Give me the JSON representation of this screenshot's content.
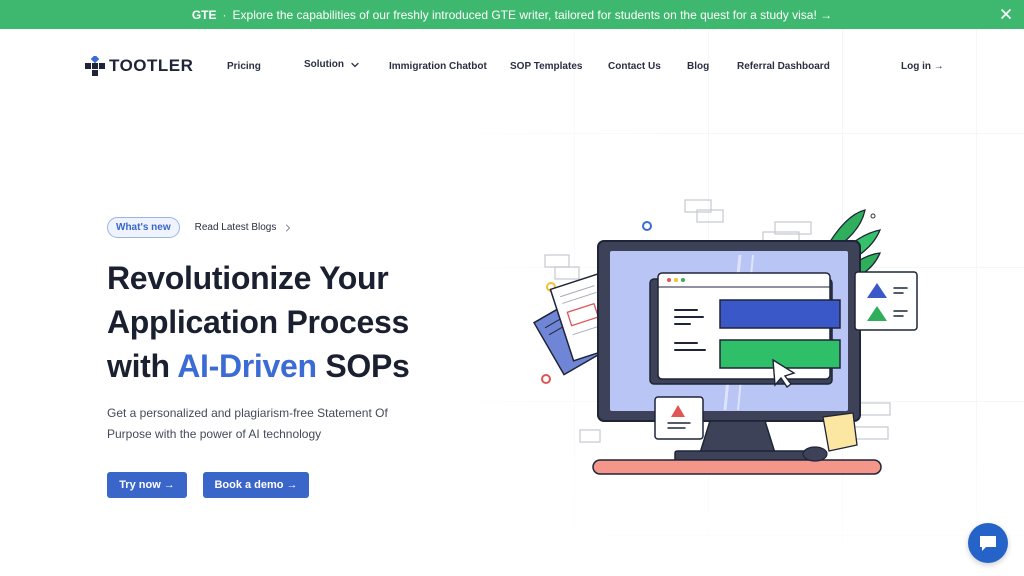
{
  "announcement": {
    "label": "GTE",
    "separator": "·",
    "text": "Explore the capabilities of our freshly introduced GTE writer, tailored for students on the quest for a study visa! →"
  },
  "brand": {
    "name": "TOOTLER"
  },
  "nav": {
    "pricing": "Pricing",
    "solution": "Solution",
    "chatbot": "Immigration Chatbot",
    "templates": "SOP Templates",
    "contact": "Contact Us",
    "blog": "Blog",
    "referral": "Referral Dashboard",
    "login": "Log in →"
  },
  "hero": {
    "badge": "What's new",
    "blog_link": "Read Latest Blogs",
    "headline_line1": "Revolutionize Your",
    "headline_line2": "Application Process",
    "headline_with": "with",
    "headline_accent": "AI-Driven",
    "headline_end": "SOPs",
    "subtext": "Get a personalized and plagiarism-free Statement Of Purpose with the power of AI technology",
    "try_now": "Try now →",
    "book_demo": "Book a demo →"
  },
  "colors": {
    "announce_bg": "#3fb86f",
    "accent": "#3b6bd4",
    "button": "#3a66c9",
    "chat": "#2563c9"
  },
  "icons": {
    "close": "close-icon",
    "chevron": "chevron-down-icon",
    "arrow": "chevron-right-icon",
    "chat": "chat-bubble-icon"
  }
}
